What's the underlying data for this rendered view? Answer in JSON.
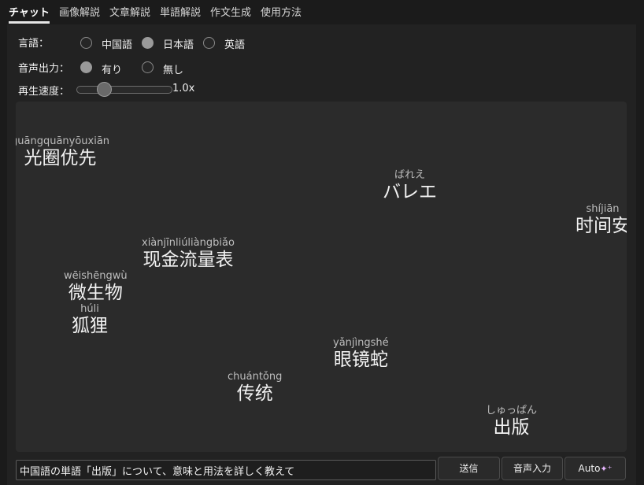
{
  "tabs": [
    {
      "label": "チャット",
      "active": true
    },
    {
      "label": "画像解説"
    },
    {
      "label": "文章解説"
    },
    {
      "label": "単語解説"
    },
    {
      "label": "作文生成"
    },
    {
      "label": "使用方法"
    }
  ],
  "settings": {
    "language": {
      "label": "言語：",
      "options": [
        "中国語",
        "日本語",
        "英語"
      ],
      "selected": "日本語"
    },
    "voice": {
      "label": "音声出力：",
      "options": [
        "有り",
        "無し"
      ],
      "selected": "有り"
    },
    "speed": {
      "label": "再生速度：",
      "value": "1.0x",
      "fraction": 0.25
    }
  },
  "words": [
    {
      "reading": "guāngquānyōuxiān",
      "surface": "光圈优先"
    },
    {
      "reading": "ばれえ",
      "surface": "バレエ"
    },
    {
      "reading": "shíjiān",
      "surface": "时间安"
    },
    {
      "reading": "xiànjīnliúliàngbiǎo",
      "surface": "现金流量表"
    },
    {
      "reading": "wēishēngwù",
      "surface": "微生物"
    },
    {
      "reading": "húli",
      "surface": "狐狸"
    },
    {
      "reading": "yǎnjìngshé",
      "surface": "眼镜蛇"
    },
    {
      "reading": "chuántǒng",
      "surface": "传统"
    },
    {
      "reading": "しゅっぱん",
      "surface": "出版"
    }
  ],
  "input": {
    "value": "中国語の単語「出版」について、意味と用法を詳しく教えて"
  },
  "buttons": {
    "send": "送信",
    "voice_input": "音声入力",
    "auto": "Auto",
    "auto_icon": "sparkles-icon"
  },
  "colors": {
    "background": "#1b1b1b",
    "panel": "#222222",
    "canvas": "#2b2b2b",
    "accent": "#e7b6ff"
  }
}
